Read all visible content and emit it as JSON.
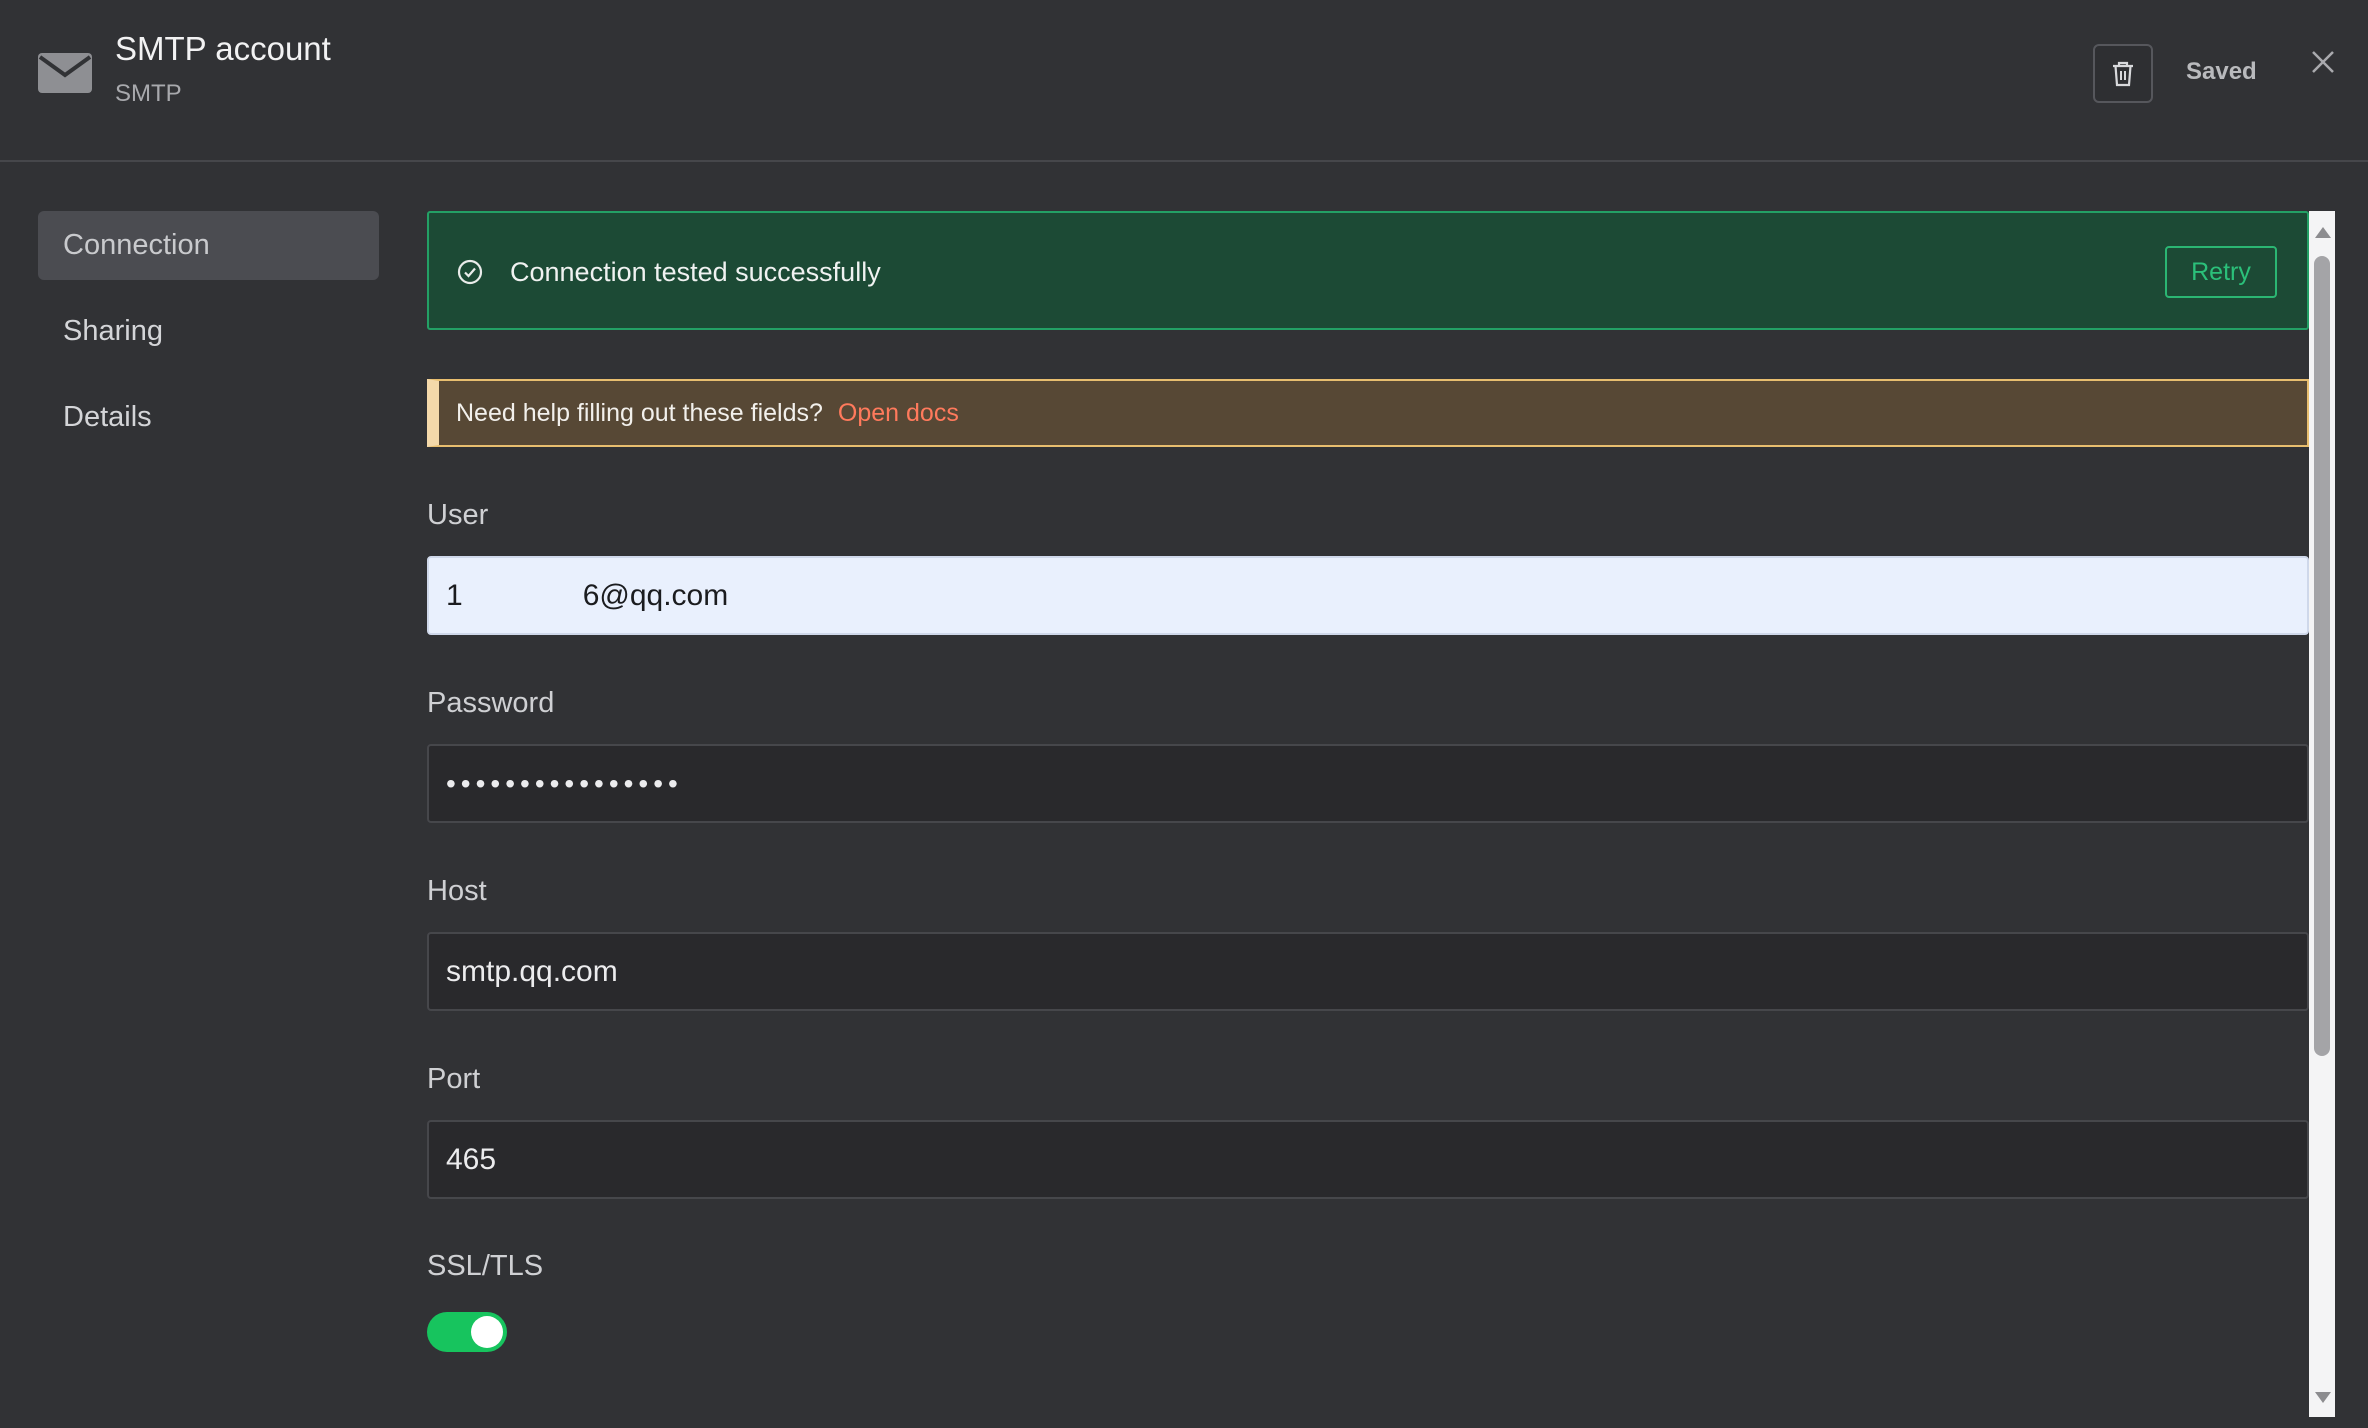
{
  "header": {
    "title": "SMTP account",
    "subtitle": "SMTP",
    "saved_label": "Saved"
  },
  "sidebar": {
    "items": [
      {
        "label": "Connection",
        "active": true
      },
      {
        "label": "Sharing",
        "active": false
      },
      {
        "label": "Details",
        "active": false
      }
    ]
  },
  "banner": {
    "success_message": "Connection tested successfully",
    "retry_label": "Retry"
  },
  "help": {
    "text": "Need help filling out these fields?",
    "link_label": "Open docs"
  },
  "fields": {
    "user": {
      "label": "User",
      "value_start": "1",
      "value_end": "6@qq.com"
    },
    "password": {
      "label": "Password",
      "value": "••••••••••••••••"
    },
    "host": {
      "label": "Host",
      "value": "smtp.qq.com"
    },
    "port": {
      "label": "Port",
      "value": "465"
    },
    "ssl": {
      "label": "SSL/TLS",
      "enabled": true
    }
  },
  "colors": {
    "background": "#313235",
    "success_bg": "#1c4a35",
    "success_border": "#23a065",
    "help_bg": "#574835",
    "help_border": "#e8be6f",
    "link": "#ff7a5c",
    "toggle_on": "#17c45e"
  },
  "icons": [
    "mail-icon",
    "trash-icon",
    "close-icon",
    "check-circle-icon"
  ]
}
